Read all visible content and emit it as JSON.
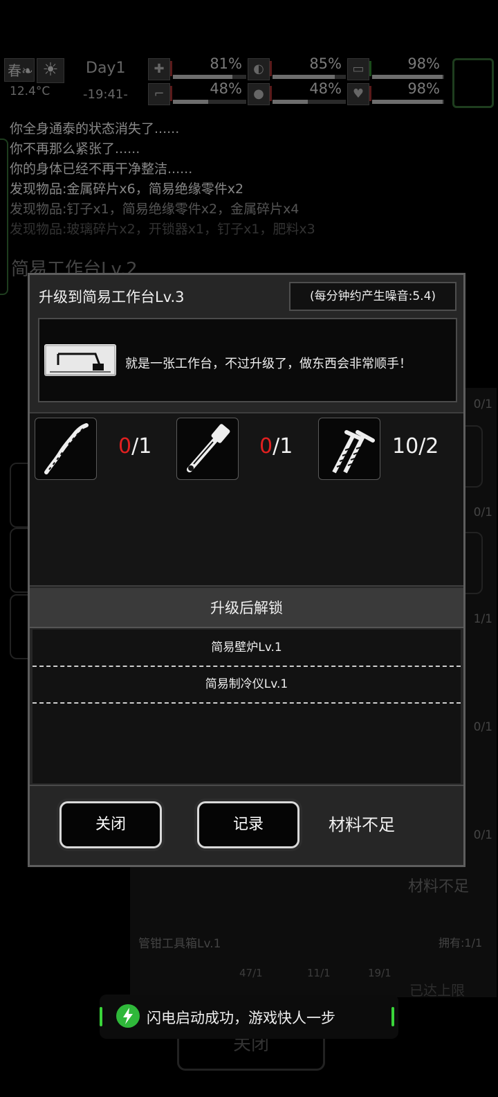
{
  "hud": {
    "season": "春",
    "temperature": "12.4°C",
    "day": "Day1",
    "time": "-19:41-",
    "stats": [
      {
        "icon": "medkit-icon",
        "percent": "81%",
        "fill": 0.81
      },
      {
        "icon": "stomach-icon",
        "percent": "85%",
        "fill": 0.85
      },
      {
        "icon": "battery-icon",
        "percent": "98%",
        "fill": 0.98
      },
      {
        "icon": "boot-icon",
        "percent": "48%",
        "fill": 0.48
      },
      {
        "icon": "water-drop-icon",
        "percent": "48%",
        "fill": 0.48
      },
      {
        "icon": "heart-icon",
        "percent": "98%",
        "fill": 0.98
      }
    ]
  },
  "log": [
    "你全身通泰的状态消失了......",
    "你不再那么紧张了......",
    "你的身体已经不再干净整洁......",
    "发现物品:金属碎片x6，简易绝缘零件x2",
    "发现物品:钉子x1，简易绝缘零件x2，金属碎片x4",
    "发现物品:玻璃碎片x2，开锁器x1，钉子x1，肥料x3"
  ],
  "background": {
    "title": "简易工作台Lv.2",
    "counts": [
      "0/1",
      "0/1",
      "1/1",
      "0/1",
      "0/1"
    ],
    "row_title": "管钳工具箱Lv.1",
    "row_owned": "拥有:1/1",
    "row_mats": [
      "47/1",
      "11/1",
      "19/1"
    ],
    "mat_short": "材料不足",
    "limit_text": "已达上限",
    "close_button": "关闭"
  },
  "dialog": {
    "title": "升级到简易工作台Lv.3",
    "noise": "(每分钟约产生噪音:5.4)",
    "description": "就是一张工作台，不过升级了，做东西会非常顺手！",
    "requirements": [
      {
        "icon": "rope-icon",
        "have": "0",
        "need": "/1",
        "insufficient": true
      },
      {
        "icon": "pipe-wrench-icon",
        "have": "0",
        "need": "/1",
        "insufficient": true
      },
      {
        "icon": "nails-icon",
        "have": "10",
        "need": "/2",
        "insufficient": false
      }
    ],
    "unlock_header": "升级后解锁",
    "unlocks": [
      "简易壁炉Lv.1",
      "简易制冷仪Lv.1"
    ],
    "buttons": {
      "close": "关闭",
      "record": "记录"
    },
    "status": "材料不足"
  },
  "toast": {
    "message": "闪电启动成功，游戏快人一步"
  }
}
